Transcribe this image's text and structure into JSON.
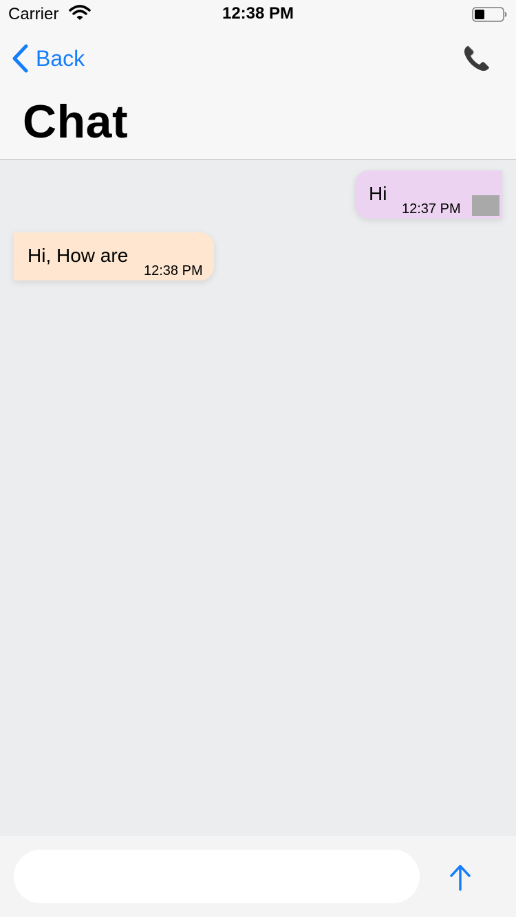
{
  "status_bar": {
    "carrier": "Carrier",
    "time": "12:38 PM",
    "wifi_icon": "wifi-icon",
    "battery_icon": "battery-icon"
  },
  "nav": {
    "back_label": "Back",
    "back_icon": "chevron-left-icon",
    "call_icon": "phone-icon",
    "title": "Chat",
    "accent_color": "#157EFB"
  },
  "messages": [
    {
      "direction": "outgoing",
      "text": "Hi",
      "time": "12:37 PM",
      "bubble_color": "#ECD3F1"
    },
    {
      "direction": "incoming",
      "text": "Hi, How are",
      "time": "12:38 PM",
      "bubble_color": "#FEE6D0"
    }
  ],
  "composer": {
    "input_value": "",
    "input_placeholder": "",
    "send_icon": "arrow-up-icon"
  }
}
